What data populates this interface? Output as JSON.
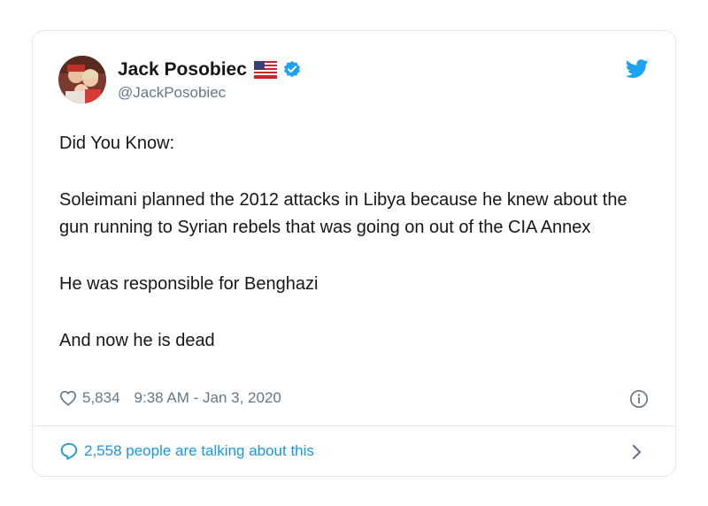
{
  "author": {
    "name": "Jack Posobiec",
    "handle": "@JackPosobiec",
    "flag_icon": "us-flag-icon",
    "verified_icon": "verified-badge-icon"
  },
  "brand": {
    "icon": "twitter-bird-icon",
    "color": "#1da1f2"
  },
  "tweet": {
    "paragraphs": [
      "Did You Know:",
      "Soleimani planned the 2012 attacks in Libya because he knew about the gun running to Syrian rebels that was going on out of the CIA Annex",
      "He was responsible for Benghazi",
      "And now he is dead"
    ]
  },
  "meta": {
    "likes": "5,834",
    "timestamp": "9:38 AM - Jan 3, 2020",
    "info_icon": "info-icon",
    "heart_icon": "heart-icon"
  },
  "footer": {
    "talking": "2,558 people are talking about this",
    "bubble_icon": "speech-bubble-icon",
    "chevron_icon": "chevron-right-icon",
    "link_color": "#1b95e0"
  }
}
